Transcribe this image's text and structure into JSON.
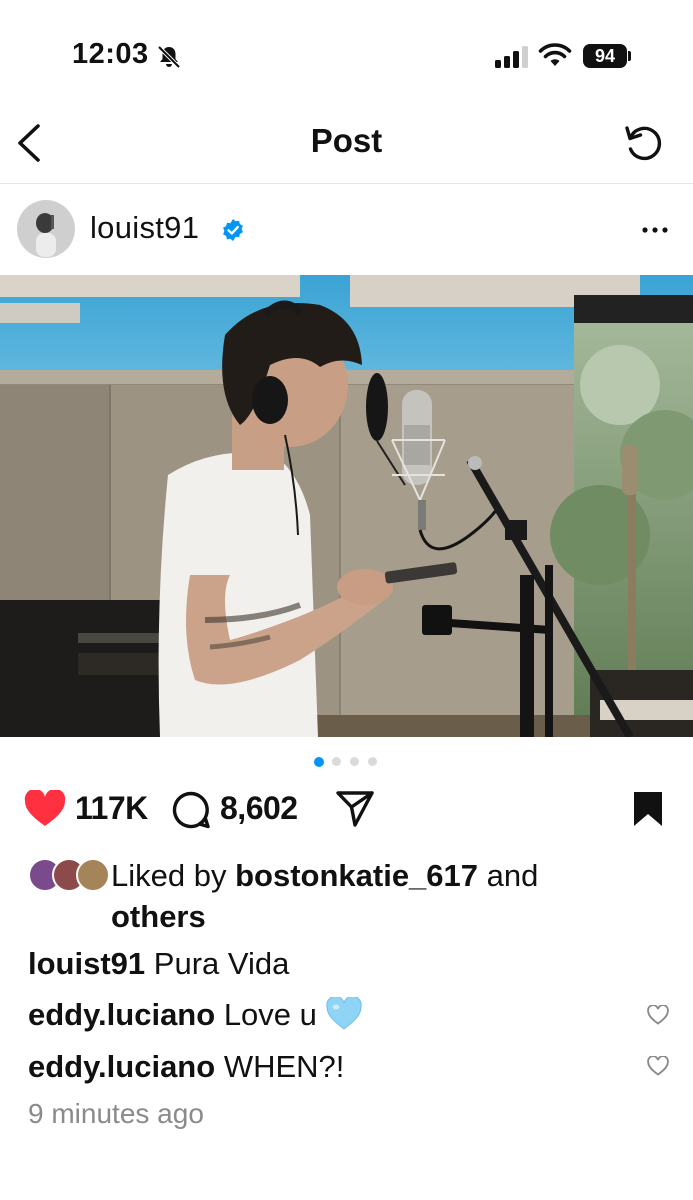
{
  "status_bar": {
    "time": "12:03",
    "battery": "94",
    "icons": [
      "bell-slash-icon",
      "signal-icon",
      "wifi-icon",
      "battery-icon"
    ]
  },
  "nav": {
    "title": "Post",
    "back_icon": "chevron-left-icon",
    "refresh_icon": "refresh-icon"
  },
  "post": {
    "author": "louist91",
    "verified": true,
    "more_icon": "ellipsis-icon",
    "carousel_pages": 4,
    "carousel_current": 1,
    "like_count": "117K",
    "comment_count": "8,602",
    "liked_by_prefix": "Liked by",
    "liked_by_user": "bostonkatie_617",
    "liked_by_and": "and",
    "liked_by_others": "others",
    "caption_user": "louist91",
    "caption_text": "Pura Vida",
    "comments": [
      {
        "user": "eddy.luciano",
        "text": "Love u",
        "emoji": "🩵"
      },
      {
        "user": "eddy.luciano",
        "text": "WHEN?!"
      }
    ],
    "time_ago": "9 minutes ago"
  },
  "colors": {
    "like_red": "#ff3040",
    "verified_blue": "#0095f6",
    "muted_text": "#8a8a8a",
    "active_dot": "#0095f6"
  }
}
